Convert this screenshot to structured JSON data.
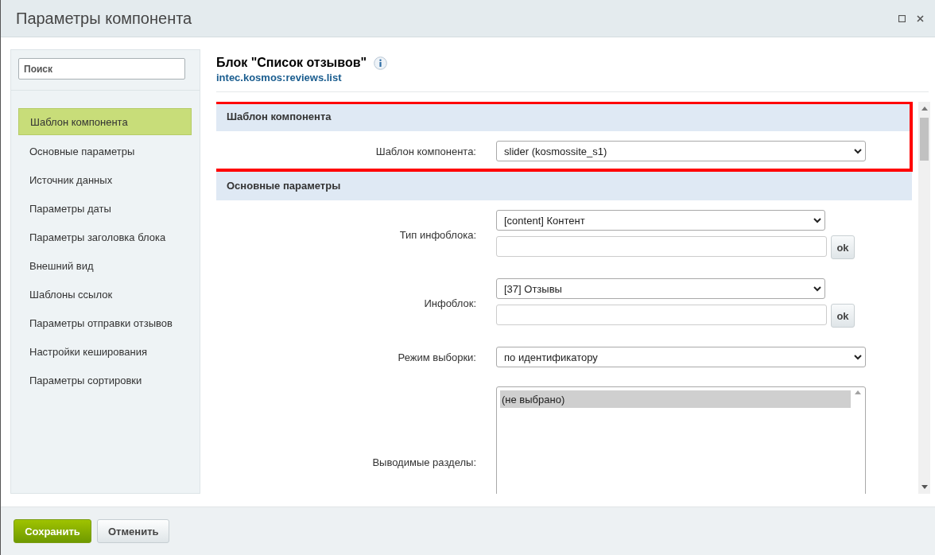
{
  "window": {
    "title": "Параметры компонента"
  },
  "sidebar": {
    "search": {
      "placeholder": "Поиск"
    },
    "items": [
      {
        "label": "Шаблон компонента",
        "selected": true
      },
      {
        "label": "Основные параметры",
        "selected": false
      },
      {
        "label": "Источник данных",
        "selected": false
      },
      {
        "label": "Параметры даты",
        "selected": false
      },
      {
        "label": "Параметры заголовка блока",
        "selected": false
      },
      {
        "label": "Внешний вид",
        "selected": false
      },
      {
        "label": "Шаблоны ссылок",
        "selected": false
      },
      {
        "label": "Параметры отправки отзывов",
        "selected": false
      },
      {
        "label": "Настройки кеширования",
        "selected": false
      },
      {
        "label": "Параметры сортировки",
        "selected": false
      }
    ]
  },
  "component": {
    "title": "Блок \"Список отзывов\"",
    "code": "intec.kosmos:reviews.list"
  },
  "sections": [
    {
      "title": "Шаблон компонента",
      "highlighted": true,
      "fields": [
        {
          "kind": "select",
          "label": "Шаблон компонента:",
          "value": "slider (kosmossite_s1)"
        }
      ]
    },
    {
      "title": "Основные параметры",
      "highlighted": false,
      "fields": [
        {
          "kind": "select_input",
          "label": "Тип инфоблока:",
          "value": "[content] Контент",
          "button": "ok"
        },
        {
          "kind": "select_input",
          "label": "Инфоблок:",
          "value": "[37] Отзывы",
          "button": "ok"
        },
        {
          "kind": "select",
          "label": "Режим выборки:",
          "value": "по идентификатору"
        },
        {
          "kind": "listbox",
          "label": "Выводимые разделы:",
          "options": [
            {
              "label": "(не выбрано)",
              "selected": true
            }
          ]
        }
      ]
    }
  ],
  "buttons": [
    {
      "kind": "primary",
      "label": "Сохранить"
    },
    {
      "kind": "secondary",
      "label": "Отменить"
    }
  ]
}
